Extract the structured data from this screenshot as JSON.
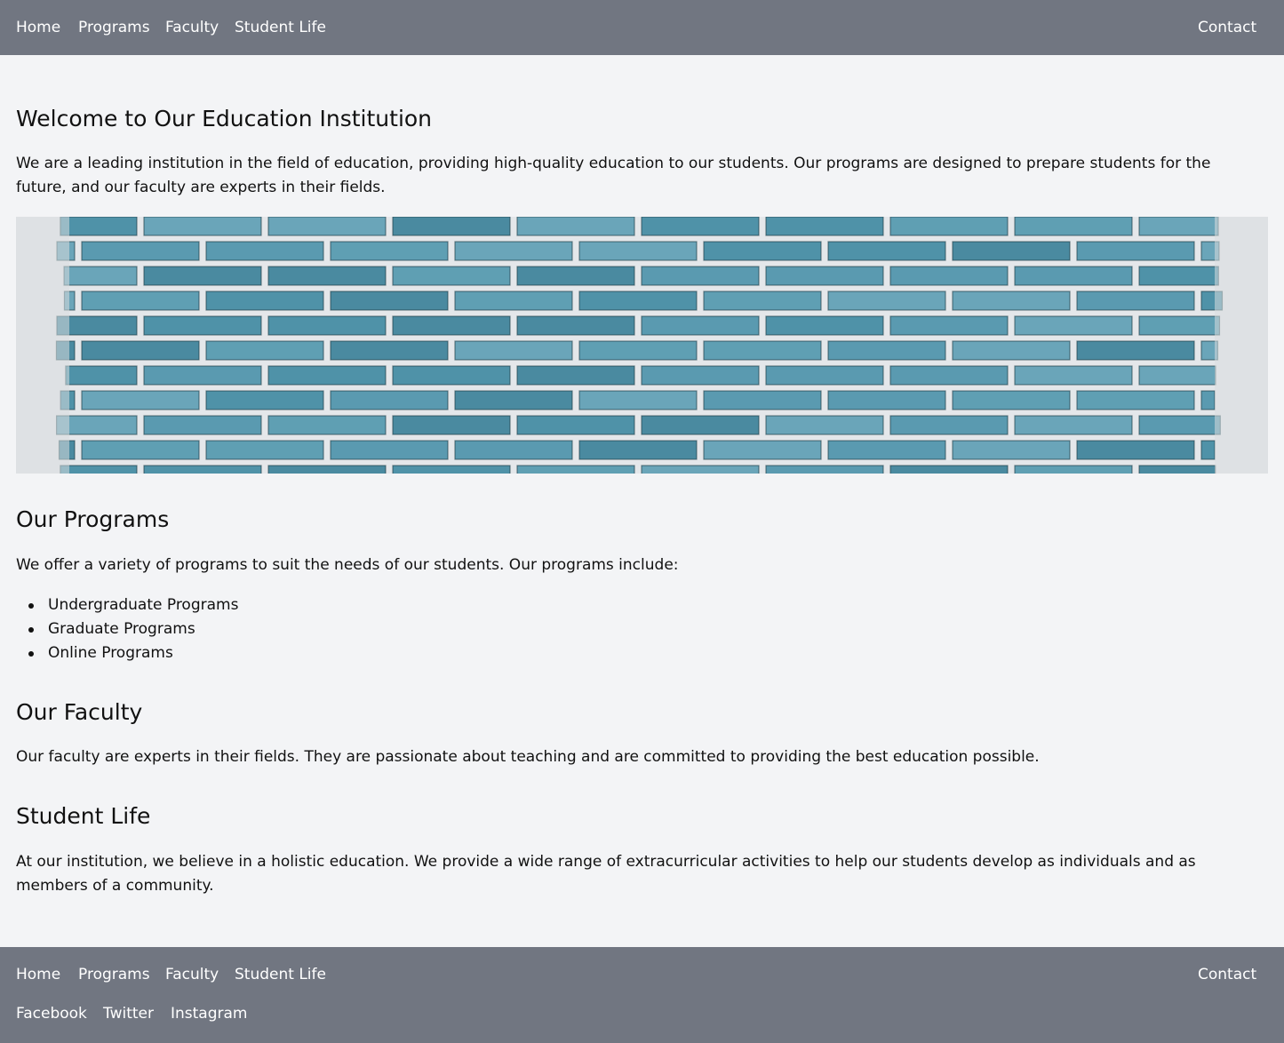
{
  "nav": {
    "links": [
      "Home",
      "Programs",
      "Faculty",
      "Student Life"
    ],
    "contact": "Contact"
  },
  "welcome": {
    "title": "Welcome to Our Education Institution",
    "body": "We are a leading institution in the field of education, providing high-quality education to our students. Our programs are designed to prepare students for the future, and our faculty are experts in their fields."
  },
  "hero": {
    "icon": "brick-wall-image",
    "colors": {
      "brick": "#5a9ab0",
      "mortar": "#e4e7ea",
      "edge": "#d9dcdf"
    }
  },
  "programs": {
    "title": "Our Programs",
    "body": "We offer a variety of programs to suit the needs of our students. Our programs include:",
    "items": [
      "Undergraduate Programs",
      "Graduate Programs",
      "Online Programs"
    ]
  },
  "faculty": {
    "title": "Our Faculty",
    "body": "Our faculty are experts in their fields. They are passionate about teaching and are committed to providing the best education possible."
  },
  "student_life": {
    "title": "Student Life",
    "body": "At our institution, we believe in a holistic education. We provide a wide range of extracurricular activities to help our students develop as individuals and as members of a community."
  },
  "footer": {
    "links": [
      "Home",
      "Programs",
      "Faculty",
      "Student Life"
    ],
    "contact": "Contact",
    "social": [
      "Facebook",
      "Twitter",
      "Instagram"
    ]
  },
  "colors": {
    "nav_bg": "#717681",
    "page_bg": "#f3f4f6",
    "nav_text": "#ffffff"
  }
}
